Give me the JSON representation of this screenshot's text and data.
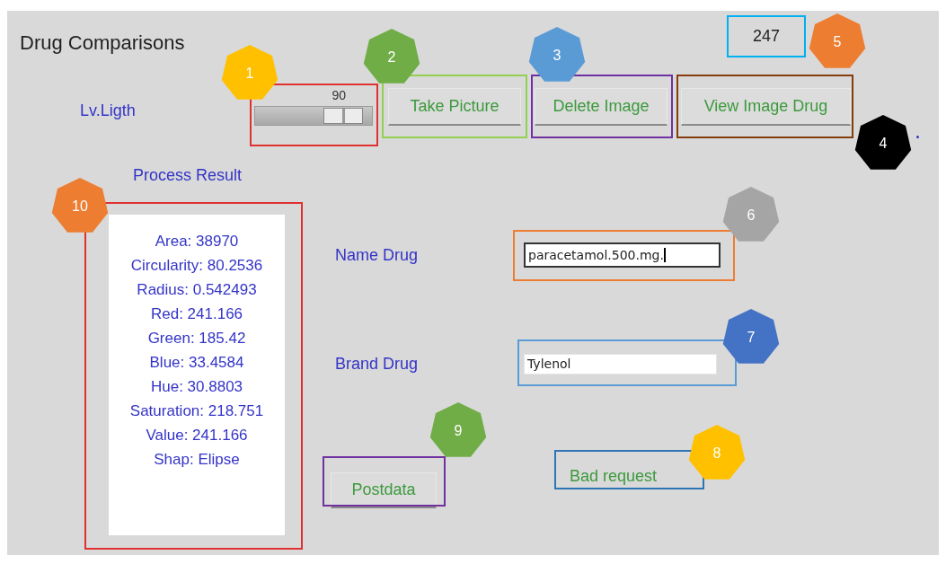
{
  "window": {
    "title": "Drug Comparisons"
  },
  "counter": "247",
  "light_slider": {
    "label": "Lv.Ligth",
    "value": "90"
  },
  "buttons": [
    {
      "label": "Take Picture"
    },
    {
      "label": "Delete Image"
    },
    {
      "label": "View Image Drug"
    }
  ],
  "process_result": {
    "title": "Process Result",
    "lines": [
      "Area: 38970",
      "Circularity: 80.2536",
      "Radius: 0.542493",
      "Red: 241.166",
      "Green: 185.42",
      "Blue: 33.4584",
      "Hue: 30.8803",
      "Saturation: 218.751",
      "Value: 241.166",
      "Shap: Elipse"
    ]
  },
  "fields": [
    {
      "label": "Name Drug",
      "value": "paracetamol.500.mg.",
      "focused": true
    },
    {
      "label": "Brand Drug",
      "value": "Tylenol",
      "focused": false
    }
  ],
  "post_button": {
    "label": "Postdata"
  },
  "status": "Bad request",
  "annotations": [
    {
      "number": "1",
      "color": "#ffc000",
      "frame": {
        "color": "#e03131"
      }
    },
    {
      "number": "2",
      "color": "#70ad47",
      "frame": {
        "color": "#92d050"
      }
    },
    {
      "number": "3",
      "color": "#5b9bd5",
      "frame": {
        "color": "#7030a0"
      }
    },
    {
      "number": "4",
      "color": "#000000",
      "frame": {
        "color": "#843c0c"
      }
    },
    {
      "number": "5",
      "color": "#ed7d31",
      "frame": {
        "color": "#00b0f0"
      }
    },
    {
      "number": "6",
      "color": "#a5a5a5",
      "frame": {
        "color": "#ed7d31"
      }
    },
    {
      "number": "7",
      "color": "#4472c4",
      "frame": {
        "color": "#5b9bd5"
      }
    },
    {
      "number": "8",
      "color": "#ffc000",
      "frame": {
        "color": "#2e75b6"
      }
    },
    {
      "number": "9",
      "color": "#70ad47",
      "frame": {
        "color": "#7030a0"
      }
    },
    {
      "number": "10",
      "color": "#ed7d31",
      "frame": {
        "color": "#e03131"
      }
    }
  ]
}
